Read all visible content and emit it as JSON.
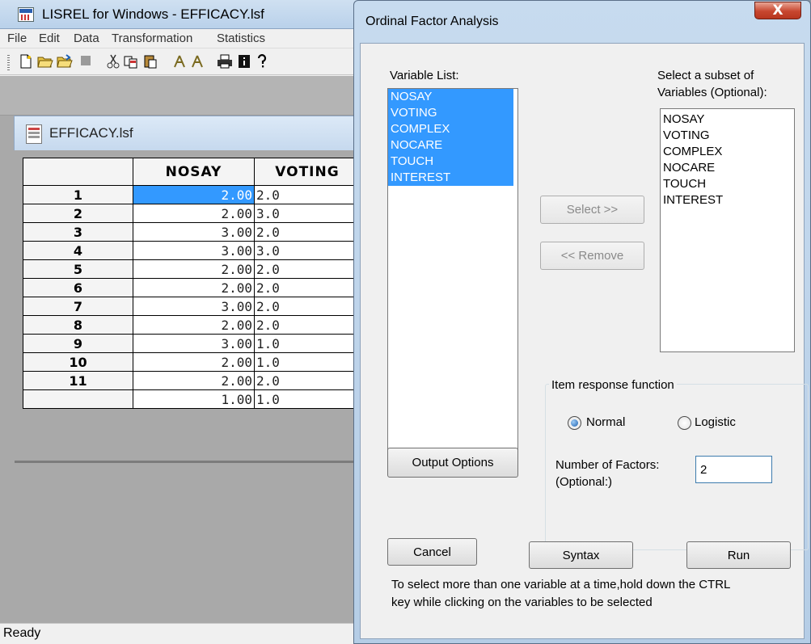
{
  "main_window": {
    "title": "LISREL for Windows - EFFICACY.lsf",
    "menu": [
      "File",
      "Edit",
      "Data",
      "Transformation",
      "Statistics"
    ],
    "toolbar_icons": [
      "new-file-icon",
      "open-icon",
      "open-alt-icon",
      "stop-icon",
      "cut-icon",
      "copy-icon",
      "paste-icon",
      "run-icon",
      "run-alt-icon",
      "print-icon",
      "info-icon",
      "help-icon"
    ],
    "document_title": "EFFICACY.lsf",
    "grid": {
      "columns": [
        "NOSAY",
        "VOTING"
      ],
      "rows": [
        {
          "label": "1",
          "NOSAY": "2.00",
          "VOTING": "2.0"
        },
        {
          "label": "2",
          "NOSAY": "2.00",
          "VOTING": "3.0"
        },
        {
          "label": "3",
          "NOSAY": "3.00",
          "VOTING": "2.0"
        },
        {
          "label": "4",
          "NOSAY": "3.00",
          "VOTING": "3.0"
        },
        {
          "label": "5",
          "NOSAY": "2.00",
          "VOTING": "2.0"
        },
        {
          "label": "6",
          "NOSAY": "2.00",
          "VOTING": "2.0"
        },
        {
          "label": "7",
          "NOSAY": "3.00",
          "VOTING": "2.0"
        },
        {
          "label": "8",
          "NOSAY": "2.00",
          "VOTING": "2.0"
        },
        {
          "label": "9",
          "NOSAY": "3.00",
          "VOTING": "1.0"
        },
        {
          "label": "10",
          "NOSAY": "2.00",
          "VOTING": "1.0"
        },
        {
          "label": "11",
          "NOSAY": "2.00",
          "VOTING": "2.0"
        },
        {
          "label": "",
          "NOSAY": "1.00",
          "VOTING": "1.0"
        }
      ],
      "selected_cell": {
        "row": "1",
        "column": "NOSAY"
      }
    },
    "status": "Ready"
  },
  "dialog": {
    "title": "Ordinal Factor Analysis",
    "close_label": "X",
    "variable_list_label": "Variable List:",
    "variables": [
      "NOSAY",
      "VOTING",
      "COMPLEX",
      "NOCARE",
      "TOUCH",
      "INTEREST"
    ],
    "subset_label_line1": "Select a subset of",
    "subset_label_line2": "Variables (Optional):",
    "subset_variables": [
      "NOSAY",
      "VOTING",
      "COMPLEX",
      "NOCARE",
      "TOUCH",
      "INTEREST"
    ],
    "select_button": "Select >>",
    "remove_button": "<< Remove",
    "output_options_button": "Output Options",
    "irf_group_label": "Item response function",
    "irf_options": {
      "normal": "Normal",
      "logistic": "Logistic",
      "selected": "Normal"
    },
    "factors_label_line1": "Number of Factors:",
    "factors_label_line2": "(Optional:)",
    "factors_value": "2",
    "cancel_button": "Cancel",
    "syntax_button": "Syntax",
    "run_button": "Run",
    "hint_line1": "To select more than one variable at a time,hold down the CTRL",
    "hint_line2": "key while clicking on the variables to be selected"
  }
}
